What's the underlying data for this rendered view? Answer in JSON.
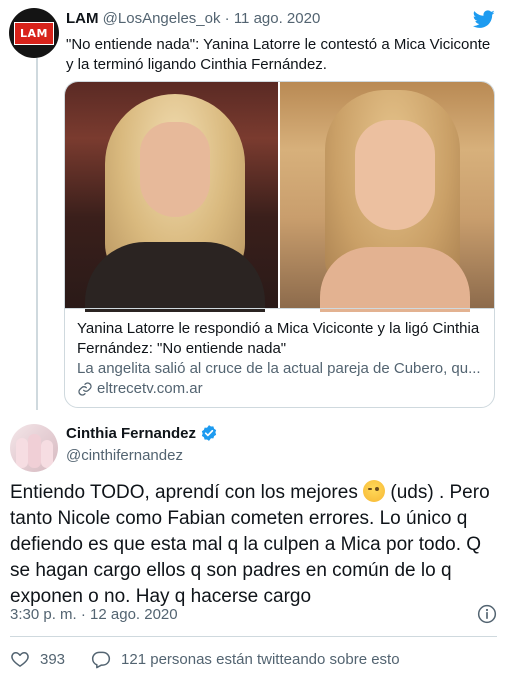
{
  "quoted_tweet": {
    "author_name": "LAM",
    "author_handle": "@LosAngeles_ok",
    "separator": "·",
    "date": "11 ago. 2020",
    "avatar_logo_text": "LAM",
    "text": "\"No entiende nada\": Yanina Latorre le contestó a Mica Viciconte y la terminó ligando Cinthia Fernández.",
    "link_card": {
      "title": "Yanina Latorre le respondió a Mica Viciconte y la ligó Cinthia Fernández: \"No entiende nada\"",
      "description": "La angelita salió al cruce de la actual pareja de Cubero, qu...",
      "domain": "eltrecetv.com.ar"
    }
  },
  "main_tweet": {
    "author_name": "Cinthia Fernandez",
    "author_handle": "@cinthifernandez",
    "text_before_emoji": "Entiendo TODO, aprendí con los mejores ",
    "text_after_emoji": " (uds) . Pero tanto Nicole como Fabian cometen errores. Lo único q defiendo es que esta mal q la culpen a Mica por todo. Q se hagan cargo ellos q son padres en común de lo q exponen o no. Hay q hacerse cargo",
    "timestamp": "3:30 p. m. · 12 ago. 2020",
    "likes": "393",
    "replies_text": "121 personas están twitteando sobre esto"
  },
  "colors": {
    "twitter_blue": "#1d9bf0",
    "text": "#0f1419",
    "secondary": "#536471",
    "border": "#cfd9de",
    "lam_red": "#d8231b"
  },
  "icons": [
    "twitter-bird-icon",
    "link-icon",
    "verified-badge-icon",
    "info-icon",
    "heart-icon",
    "reply-bubble-icon",
    "winking-face-emoji"
  ]
}
